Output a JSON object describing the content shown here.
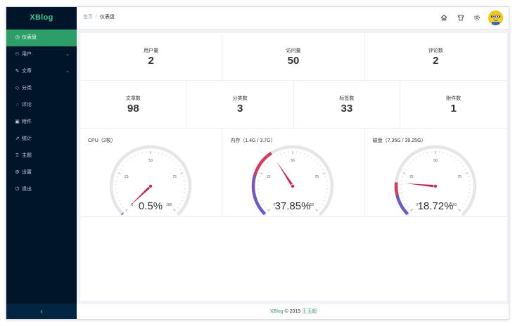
{
  "sidebar": {
    "logo": "XBlog",
    "items": [
      {
        "label": "仪表盘",
        "icon": "dashboard-icon",
        "active": true,
        "expandable": false
      },
      {
        "label": "用户",
        "icon": "user-icon",
        "active": false,
        "expandable": true
      },
      {
        "label": "文章",
        "icon": "edit-icon",
        "active": false,
        "expandable": true
      },
      {
        "label": "分类",
        "icon": "tag-icon",
        "active": false,
        "expandable": false
      },
      {
        "label": "评论",
        "icon": "comment-icon",
        "active": false,
        "expandable": false
      },
      {
        "label": "附件",
        "icon": "picture-icon",
        "active": false,
        "expandable": false
      },
      {
        "label": "统计",
        "icon": "chart-icon",
        "active": false,
        "expandable": false
      },
      {
        "label": "主题",
        "icon": "shirt-icon",
        "active": false,
        "expandable": false
      },
      {
        "label": "设置",
        "icon": "gear-icon",
        "active": false,
        "expandable": false
      },
      {
        "label": "退出",
        "icon": "power-icon",
        "active": false,
        "expandable": false
      }
    ],
    "collapse_icon": "chevron-left-icon"
  },
  "header": {
    "breadcrumb": [
      "首页",
      "仪表盘"
    ],
    "icons": [
      "home-icon",
      "shirt-icon",
      "gear-icon"
    ]
  },
  "stats_row1": [
    {
      "label": "用户量",
      "value": "2"
    },
    {
      "label": "访问量",
      "value": "50"
    },
    {
      "label": "评论数",
      "value": "2"
    }
  ],
  "stats_row2": [
    {
      "label": "文章数",
      "value": "98"
    },
    {
      "label": "分类数",
      "value": "3"
    },
    {
      "label": "标签数",
      "value": "33"
    },
    {
      "label": "附件数",
      "value": "1"
    }
  ],
  "gauges": [
    {
      "title": "CPU（2核）",
      "value": 0.5,
      "display": "0.5%"
    },
    {
      "title": "内存（1.4G / 3.7G）",
      "value": 37.85,
      "display": "37.85%"
    },
    {
      "title": "磁盘（7.35G / 39.25G）",
      "value": 18.72,
      "display": "18.72%"
    }
  ],
  "gauge_ticks": [
    "0",
    "25",
    "50",
    "75",
    "100"
  ],
  "colors": {
    "accent": "#2d9e67",
    "sidebar_bg": "#001529",
    "gauge_track": "#e6e6e6",
    "gauge_start": "#5b5bd6",
    "gauge_end": "#d9365e",
    "pointer": "#c8254a"
  },
  "footer": {
    "brand": "XBlog",
    "copyright": " © 2019 ",
    "author": "王玉超"
  }
}
